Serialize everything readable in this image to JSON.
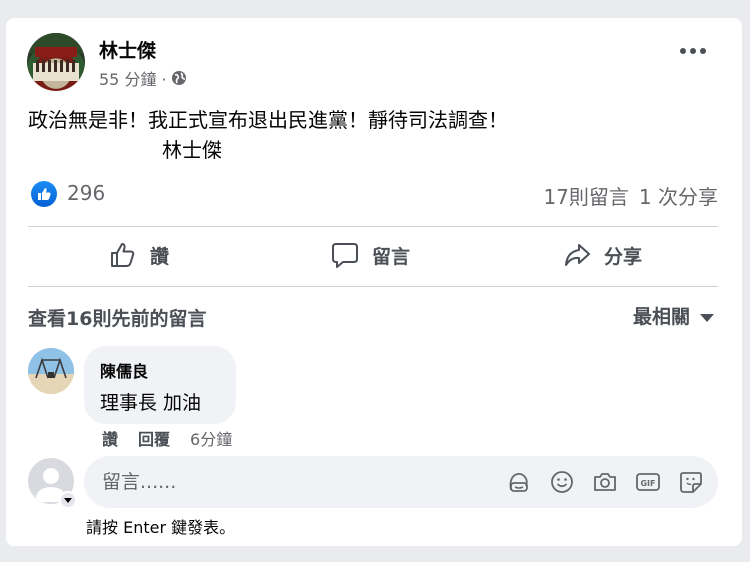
{
  "post": {
    "author_name": "林士傑",
    "time": "55 分鐘 ·",
    "privacy_icon": "globe-icon",
    "text": "政治無是非！我正式宣布退出民進黨！靜待司法調查！",
    "signature": "林士傑"
  },
  "stats": {
    "like_count": "296",
    "comments": "17則留言",
    "shares": "1 次分享"
  },
  "actions": {
    "like": "讚",
    "comment": "留言",
    "share": "分享"
  },
  "comments_section": {
    "view_previous": "查看16則先前的留言",
    "sort": "最相關"
  },
  "comment": {
    "author": "陳儒良",
    "text": "理事長 加油",
    "like": "讚",
    "reply": "回覆",
    "time": "6分鐘"
  },
  "composer": {
    "placeholder": "留言......",
    "hint": "請按 Enter 鍵發表。"
  },
  "colors": {
    "like_blue": "#1877f2",
    "secondary_text": "#65676b",
    "bubble_bg": "#f0f2f5"
  }
}
